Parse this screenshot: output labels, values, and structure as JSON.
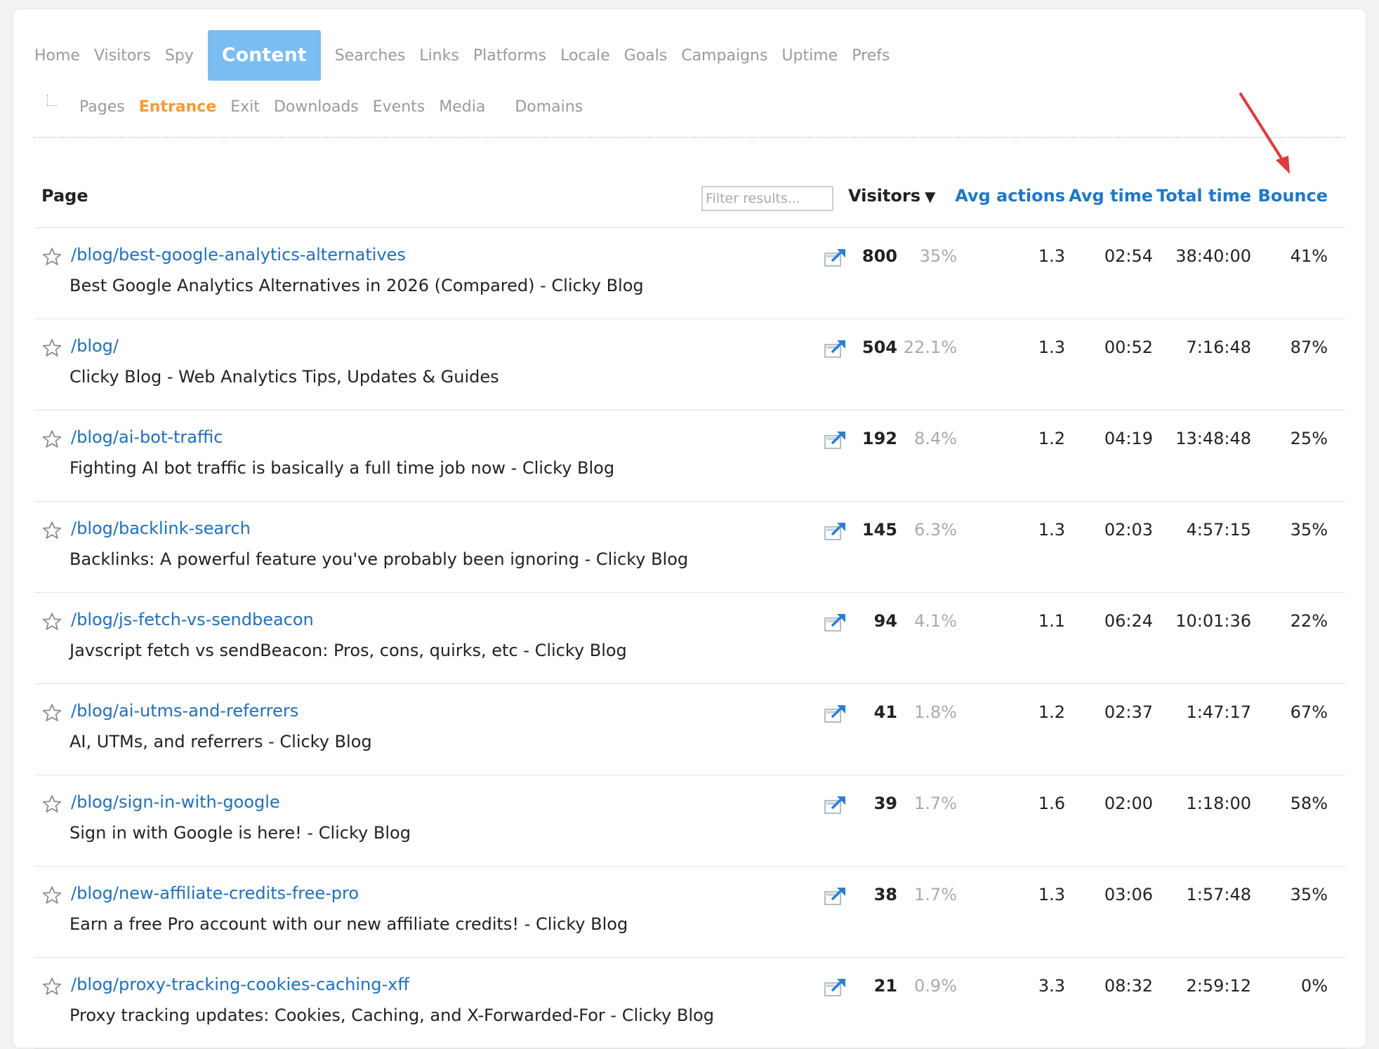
{
  "primary_nav": [
    {
      "label": "Home",
      "active": false
    },
    {
      "label": "Visitors",
      "active": false
    },
    {
      "label": "Spy",
      "active": false
    },
    {
      "label": "Content",
      "active": true
    },
    {
      "label": "Searches",
      "active": false
    },
    {
      "label": "Links",
      "active": false
    },
    {
      "label": "Platforms",
      "active": false
    },
    {
      "label": "Locale",
      "active": false
    },
    {
      "label": "Goals",
      "active": false
    },
    {
      "label": "Campaigns",
      "active": false
    },
    {
      "label": "Uptime",
      "active": false
    },
    {
      "label": "Prefs",
      "active": false
    }
  ],
  "secondary_nav": [
    {
      "label": "Pages",
      "active": false
    },
    {
      "label": "Entrance",
      "active": true
    },
    {
      "label": "Exit",
      "active": false
    },
    {
      "label": "Downloads",
      "active": false
    },
    {
      "label": "Events",
      "active": false
    },
    {
      "label": "Media",
      "active": false
    },
    {
      "label": "Domains",
      "active": false
    }
  ],
  "table": {
    "headers": {
      "page": "Page",
      "filter_placeholder": "Filter results...",
      "visitors": "Visitors",
      "sort_indicator": "▼",
      "avg_actions": "Avg actions",
      "avg_time": "Avg time",
      "total_time": "Total time",
      "bounce": "Bounce"
    },
    "rows": [
      {
        "path": "/blog/best-google-analytics-alternatives",
        "title": "Best Google Analytics Alternatives in 2026 (Compared) - Clicky Blog",
        "visitors": "800",
        "pct": "35%",
        "avg_actions": "1.3",
        "avg_time": "02:54",
        "total_time": "38:40:00",
        "bounce": "41%"
      },
      {
        "path": "/blog/",
        "title": "Clicky Blog - Web Analytics Tips, Updates & Guides",
        "visitors": "504",
        "pct": "22.1%",
        "avg_actions": "1.3",
        "avg_time": "00:52",
        "total_time": "7:16:48",
        "bounce": "87%"
      },
      {
        "path": "/blog/ai-bot-traffic",
        "title": "Fighting AI bot traffic is basically a full time job now - Clicky Blog",
        "visitors": "192",
        "pct": "8.4%",
        "avg_actions": "1.2",
        "avg_time": "04:19",
        "total_time": "13:48:48",
        "bounce": "25%"
      },
      {
        "path": "/blog/backlink-search",
        "title": "Backlinks: A powerful feature you've probably been ignoring - Clicky Blog",
        "visitors": "145",
        "pct": "6.3%",
        "avg_actions": "1.3",
        "avg_time": "02:03",
        "total_time": "4:57:15",
        "bounce": "35%"
      },
      {
        "path": "/blog/js-fetch-vs-sendbeacon",
        "title": "Javscript fetch vs sendBeacon: Pros, cons, quirks, etc - Clicky Blog",
        "visitors": "94",
        "pct": "4.1%",
        "avg_actions": "1.1",
        "avg_time": "06:24",
        "total_time": "10:01:36",
        "bounce": "22%"
      },
      {
        "path": "/blog/ai-utms-and-referrers",
        "title": "AI, UTMs, and referrers - Clicky Blog",
        "visitors": "41",
        "pct": "1.8%",
        "avg_actions": "1.2",
        "avg_time": "02:37",
        "total_time": "1:47:17",
        "bounce": "67%"
      },
      {
        "path": "/blog/sign-in-with-google",
        "title": "Sign in with Google is here! - Clicky Blog",
        "visitors": "39",
        "pct": "1.7%",
        "avg_actions": "1.6",
        "avg_time": "02:00",
        "total_time": "1:18:00",
        "bounce": "58%"
      },
      {
        "path": "/blog/new-affiliate-credits-free-pro",
        "title": "Earn a free Pro account with our new affiliate credits! - Clicky Blog",
        "visitors": "38",
        "pct": "1.7%",
        "avg_actions": "1.3",
        "avg_time": "03:06",
        "total_time": "1:57:48",
        "bounce": "35%"
      },
      {
        "path": "/blog/proxy-tracking-cookies-caching-xff",
        "title": "Proxy tracking updates: Cookies, Caching, and X-Forwarded-For - Clicky Blog",
        "visitors": "21",
        "pct": "0.9%",
        "avg_actions": "3.3",
        "avg_time": "08:32",
        "total_time": "2:59:12",
        "bounce": "0%"
      }
    ]
  },
  "icons": {
    "star": "star-outline-icon",
    "external": "external-link-icon",
    "annotation": "red-arrow-annotation"
  },
  "colors": {
    "link": "#1e6fc0",
    "header_link": "#1e78c8",
    "active_tab": "#79bdf2",
    "active_subtab": "#f59a33",
    "annotation": "#e03a3a"
  }
}
